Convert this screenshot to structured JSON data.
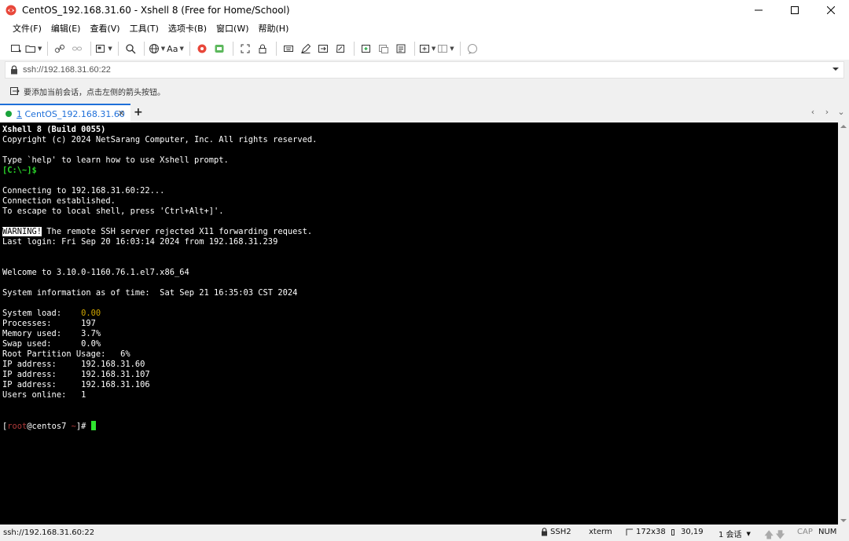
{
  "window": {
    "title": "CentOS_192.168.31.60 - Xshell 8 (Free for Home/School)"
  },
  "menu": [
    "文件(F)",
    "编辑(E)",
    "查看(V)",
    "工具(T)",
    "选项卡(B)",
    "窗口(W)",
    "帮助(H)"
  ],
  "toolbar": {
    "font_label": "Aa"
  },
  "address": {
    "value": "ssh://192.168.31.60:22"
  },
  "hint": {
    "text": "要添加当前会话，点击左侧的箭头按钮。"
  },
  "tabs": [
    {
      "index": "1",
      "label": "CentOS_192.168.31.60",
      "active": true
    }
  ],
  "terminal": {
    "lines": [
      "Xshell 8 (Build 0055)",
      "Copyright (c) 2024 NetSarang Computer, Inc. All rights reserved.",
      "",
      "Type `help' to learn how to use Xshell prompt.",
      "[C:\\~]$",
      "",
      "Connecting to 192.168.31.60:22...",
      "Connection established.",
      "To escape to local shell, press 'Ctrl+Alt+]'.",
      "",
      "WARNING!",
      " The remote SSH server rejected X11 forwarding request.",
      "Last login: Fri Sep 20 16:03:14 2024 from 192.168.31.239",
      "",
      "",
      "Welcome to 3.10.0-1160.76.1.el7.x86_64",
      "",
      "System information as of time:  Sat Sep 21 16:35:03 CST 2024",
      "",
      "System load:    ",
      "0.00",
      "Processes:      197",
      "Memory used:    3.7%",
      "Swap used:      0.0%",
      "Root Partition Usage:   6%",
      "IP address:     192.168.31.60",
      "IP address:     192.168.31.107",
      "IP address:     192.168.31.106",
      "Users online:   1",
      "[",
      "root",
      "@centos7 ",
      "~",
      "]# "
    ]
  },
  "status": {
    "connection": "ssh://192.168.31.60:22",
    "protocol": "SSH2",
    "terminal_type": "xterm",
    "size": "172x38",
    "cursor_pos": "30,19",
    "sessions": "1 会话",
    "caps": "CAP",
    "num": "NUM"
  },
  "colors": {
    "accent": "#1e6fd9",
    "terminal_bg": "#000000",
    "prompt_green": "#29d329",
    "load_yellow": "#cfa500",
    "cursor_green": "#2fe52f"
  }
}
